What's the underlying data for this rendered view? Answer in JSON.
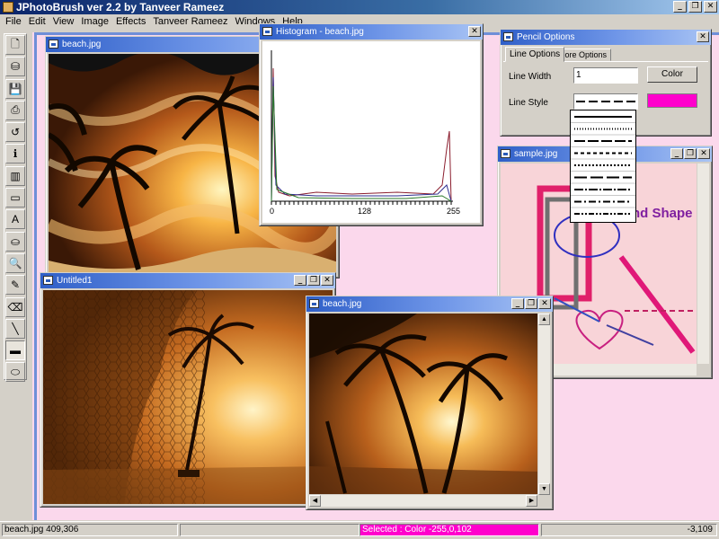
{
  "app": {
    "title": "JPhotoBrush  ver 2.2 by Tanveer Rameez"
  },
  "window_buttons": {
    "minimize": "_",
    "restore": "❐",
    "close": "✕"
  },
  "menu": [
    {
      "label": "File"
    },
    {
      "label": "Edit"
    },
    {
      "label": "View"
    },
    {
      "label": "Image"
    },
    {
      "label": "Effects"
    },
    {
      "label": "Tanveer Rameez"
    },
    {
      "label": "Windows"
    },
    {
      "label": "Help"
    }
  ],
  "tools": [
    {
      "name": "new-file-icon",
      "glyph": "🗋"
    },
    {
      "name": "open-file-icon",
      "glyph": "⛁"
    },
    {
      "name": "save-icon",
      "glyph": "💾"
    },
    {
      "name": "print-icon",
      "glyph": "⎙"
    },
    {
      "name": "undo-icon",
      "glyph": "↺"
    },
    {
      "name": "info-icon",
      "glyph": "ℹ"
    },
    {
      "name": "palette-icon",
      "glyph": "▥"
    },
    {
      "name": "rectangle-select-icon",
      "glyph": "▭"
    },
    {
      "name": "text-tool-icon",
      "glyph": "A"
    },
    {
      "name": "fill-bucket-icon",
      "glyph": "⛀"
    },
    {
      "name": "zoom-icon",
      "glyph": "🔍"
    },
    {
      "name": "eyedropper-icon",
      "glyph": "✎"
    },
    {
      "name": "eraser-icon",
      "glyph": "⌫"
    },
    {
      "name": "line-tool-icon",
      "glyph": "╲"
    },
    {
      "name": "rectangle-tool-icon",
      "glyph": "▬"
    },
    {
      "name": "ellipse-tool-icon",
      "glyph": "⬭"
    }
  ],
  "windows": {
    "beach1": {
      "title": "beach.jpg"
    },
    "histogram": {
      "title": "Histogram - beach.jpg",
      "axis_labels": [
        "0",
        "128",
        "255"
      ]
    },
    "pencil": {
      "title": "Pencil Options",
      "tabs": [
        "Line Options",
        "More Options"
      ],
      "line_width_label": "Line Width",
      "line_width_value": "1",
      "color_button": "Color",
      "line_style_label": "Line Style",
      "color": "#ff00cc"
    },
    "sample": {
      "title": "sample.jpg",
      "text": "nd Shape"
    },
    "untitled": {
      "title": "Untitled1"
    },
    "beach2": {
      "title": "beach.jpg"
    }
  },
  "status": {
    "left": "beach.jpg  409,306",
    "middle": "Selected : Color -255,0,102",
    "right": "-3,109"
  }
}
